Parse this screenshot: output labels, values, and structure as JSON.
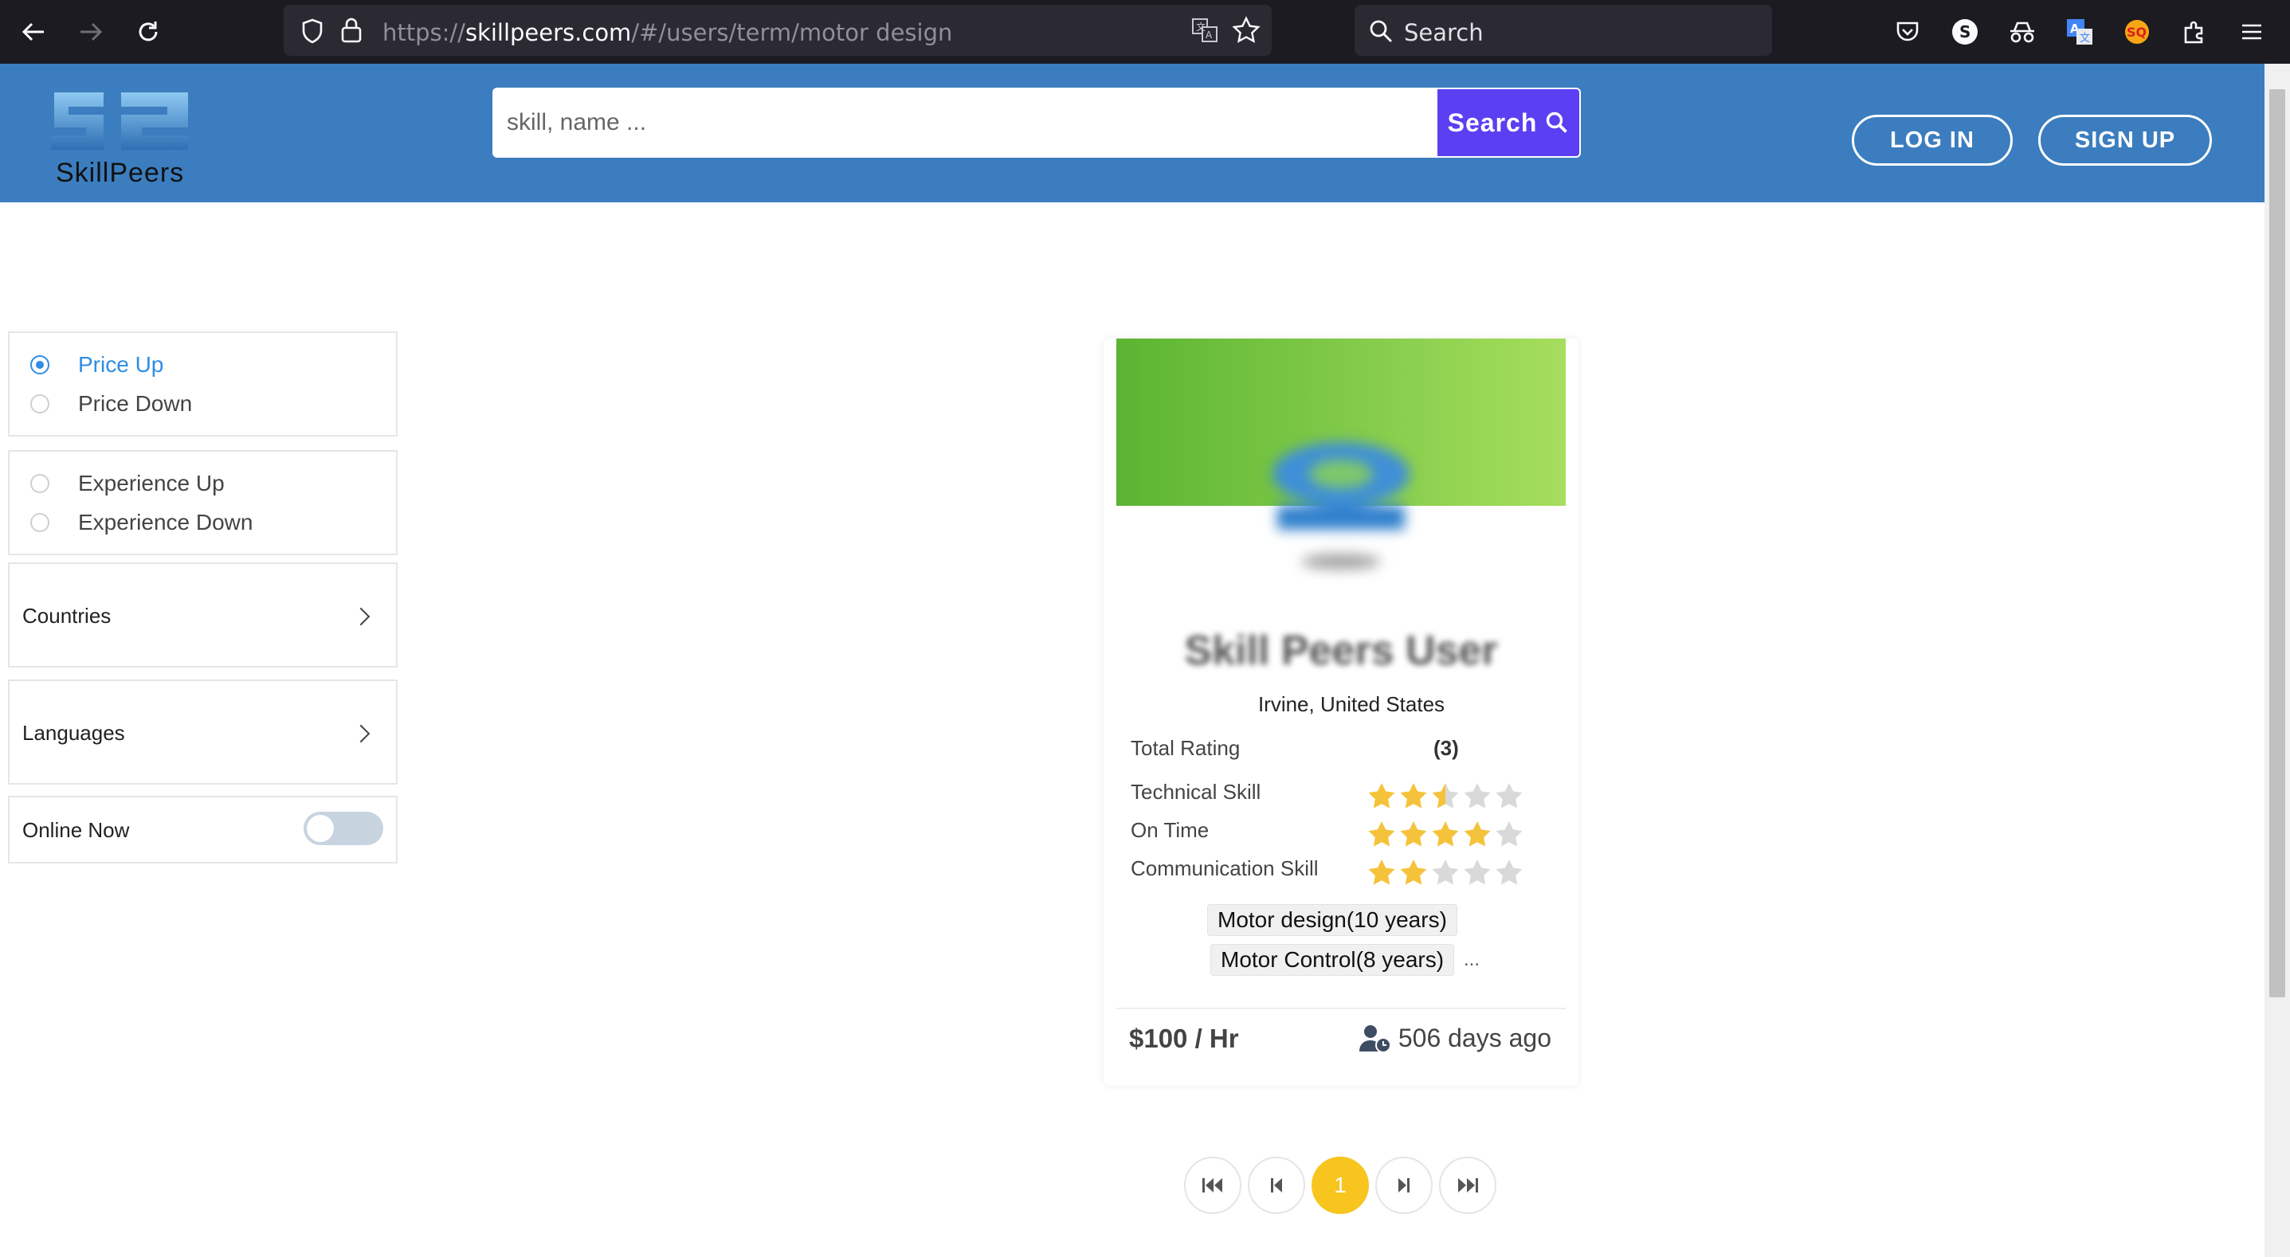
{
  "browser": {
    "url_prefix": "https://",
    "url_host": "skillpeers.com",
    "url_path": "/#/users/term/motor design",
    "search_label": "Search"
  },
  "header": {
    "logo_text": "SkillPeers",
    "search_placeholder": "skill, name ...",
    "search_button": "Search",
    "login": "LOG IN",
    "signup": "SIGN UP",
    "brand_color": "#3b7dbf",
    "accent_color": "#5b3ff2"
  },
  "filters": {
    "price": [
      {
        "label": "Price Up",
        "selected": true
      },
      {
        "label": "Price Down",
        "selected": false
      }
    ],
    "experience": [
      {
        "label": "Experience Up",
        "selected": false
      },
      {
        "label": "Experience Down",
        "selected": false
      }
    ],
    "countries": "Countries",
    "languages": "Languages",
    "online_now": "Online Now",
    "online_now_on": false
  },
  "card": {
    "name": "Skill Peers User",
    "location": "Irvine, United States",
    "total_rating_label": "Total Rating",
    "total_rating_count": "(3)",
    "ratings": [
      {
        "label": "Technical Skill",
        "stars": 2.5
      },
      {
        "label": "On Time",
        "stars": 4
      },
      {
        "label": "Communication Skill",
        "stars": 2
      }
    ],
    "skills": [
      "Motor design(10 years)",
      "Motor Control(8 years)"
    ],
    "more": "...",
    "price": "$100 / Hr",
    "last_seen": "506 days ago"
  },
  "pagination": {
    "current": "1"
  }
}
